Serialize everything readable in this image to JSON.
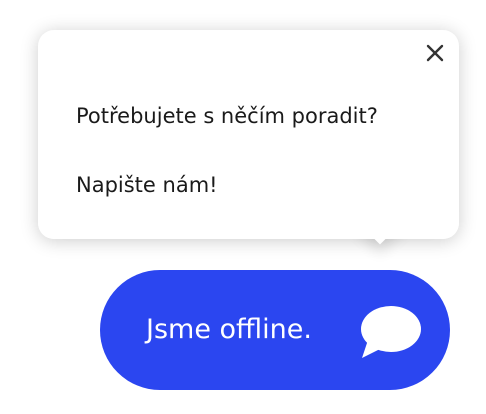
{
  "popup": {
    "message_line_1": "Potřebujete s něčím poradit?",
    "message_line_2": "Napište nám!",
    "close_icon": "close-icon"
  },
  "chat_button": {
    "status_label": "Jsme offline.",
    "icon": "speech-bubble-icon",
    "accent_color": "#2b46f0"
  }
}
